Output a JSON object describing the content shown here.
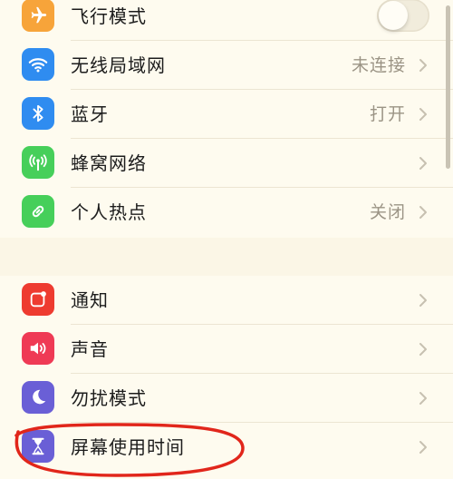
{
  "colors": {
    "airplane": "#f7a43a",
    "wifi": "#2f8cf0",
    "bluetooth": "#2f8cf0",
    "cellular": "#46cf5a",
    "hotspot": "#46cf5a",
    "notifications": "#ee3b30",
    "sounds": "#ef3a55",
    "dnd": "#6a5fd6",
    "screentime": "#6a5fd6",
    "annotation": "#e1261b"
  },
  "group1": [
    {
      "key": "airplane",
      "label": "飞行模式",
      "icon": "airplane-icon",
      "toggle": true,
      "toggle_state": "off"
    },
    {
      "key": "wifi",
      "label": "无线局域网",
      "icon": "wifi-icon",
      "value": "未连接"
    },
    {
      "key": "bluetooth",
      "label": "蓝牙",
      "icon": "bluetooth-icon",
      "value": "打开"
    },
    {
      "key": "cellular",
      "label": "蜂窝网络",
      "icon": "antenna-icon",
      "value": ""
    },
    {
      "key": "hotspot",
      "label": "个人热点",
      "icon": "hotspot-icon",
      "value": "关闭"
    }
  ],
  "group2": [
    {
      "key": "notifications",
      "label": "通知",
      "icon": "notification-icon"
    },
    {
      "key": "sounds",
      "label": "声音",
      "icon": "speaker-icon"
    },
    {
      "key": "dnd",
      "label": "勿扰模式",
      "icon": "moon-icon"
    },
    {
      "key": "screentime",
      "label": "屏幕使用时间",
      "icon": "hourglass-icon"
    }
  ]
}
